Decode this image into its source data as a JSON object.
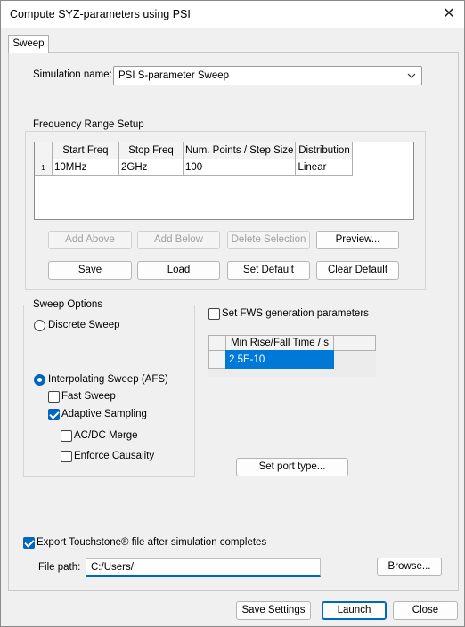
{
  "window": {
    "title": "Compute SYZ-parameters using PSI"
  },
  "tabs": [
    {
      "label": "Sweep"
    }
  ],
  "simulation": {
    "label": "Simulation name:",
    "value": "PSI S-parameter Sweep"
  },
  "frequency_range": {
    "label": "Frequency Range Setup",
    "columns": [
      "Start Freq",
      "Stop Freq",
      "Num. Points / Step Size",
      "Distribution"
    ],
    "rows": [
      {
        "index": "1",
        "cells": [
          "10MHz",
          "2GHz",
          "100",
          "Linear"
        ]
      }
    ],
    "buttons": {
      "add_above": "Add Above",
      "add_below": "Add Below",
      "delete_selection": "Delete Selection",
      "preview": "Preview...",
      "save": "Save",
      "load": "Load",
      "set_default": "Set Default",
      "clear_default": "Clear Default"
    }
  },
  "sweep_options": {
    "label": "Sweep Options",
    "discrete": {
      "label": "Discrete Sweep",
      "checked": false
    },
    "interpolating": {
      "label": "Interpolating Sweep (AFS)",
      "checked": true
    },
    "fast_sweep": {
      "label": "Fast Sweep",
      "checked": false
    },
    "adaptive_sampling": {
      "label": "Adaptive Sampling",
      "checked": true
    },
    "acdc_merge": {
      "label": "AC/DC Merge",
      "checked": false
    },
    "enforce_causality": {
      "label": "Enforce Causality",
      "checked": false
    }
  },
  "fws": {
    "label": "Set FWS generation parameters",
    "checked": false,
    "column": "Min Rise/Fall Time / s",
    "value": "2.5E-10"
  },
  "set_port_type": "Set port type...",
  "export": {
    "label": "Export Touchstone® file after simulation completes",
    "checked": true,
    "file_path_label": "File path:",
    "file_path": "C:/Users/",
    "browse": "Browse..."
  },
  "footer": {
    "save_settings": "Save Settings",
    "launch": "Launch",
    "close": "Close"
  },
  "colors": {
    "accent": "#0067c0",
    "selection": "#0078d7"
  }
}
